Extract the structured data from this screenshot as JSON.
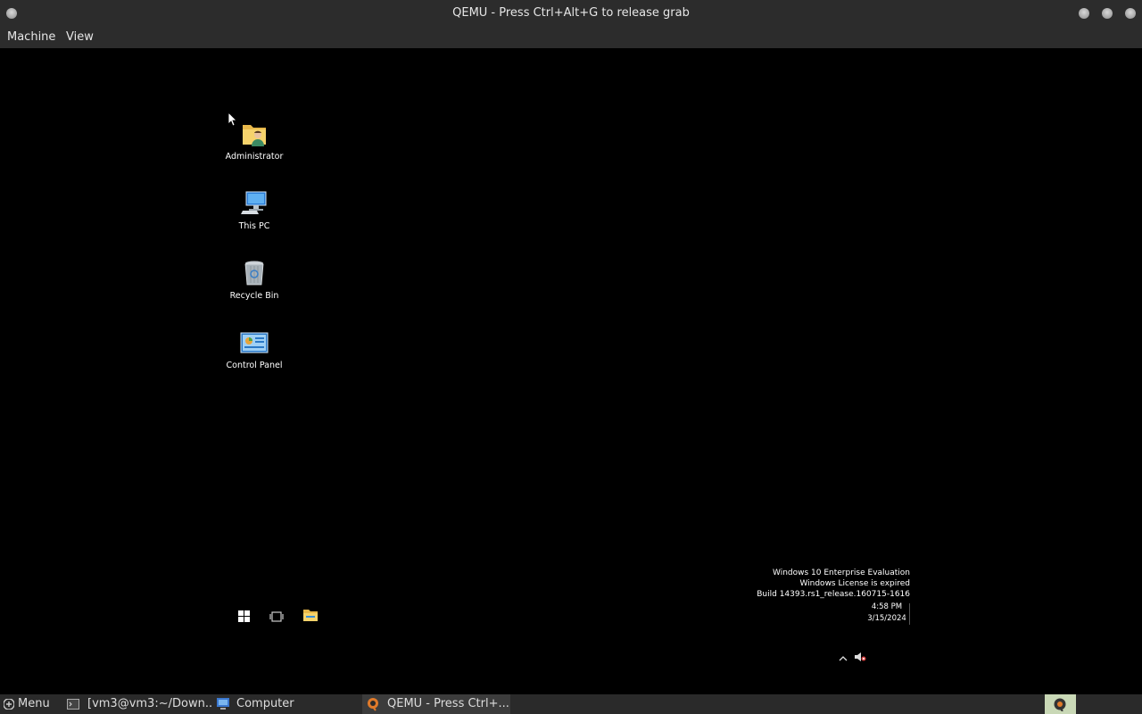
{
  "window": {
    "title": "QEMU - Press Ctrl+Alt+G to release grab"
  },
  "menubar": {
    "items": [
      "Machine",
      "View"
    ]
  },
  "desktop": {
    "icons": [
      {
        "label": "Administrator",
        "icon": "user-folder-icon"
      },
      {
        "label": "This PC",
        "icon": "computer-icon"
      },
      {
        "label": "Recycle Bin",
        "icon": "recycle-bin-icon"
      },
      {
        "label": "Control Panel",
        "icon": "control-panel-icon"
      }
    ],
    "watermark": {
      "line1": "Windows 10 Enterprise Evaluation",
      "line2": "Windows License is expired",
      "line3": "Build 14393.rs1_release.160715-1616"
    },
    "clock": {
      "time": "4:58 PM",
      "date": "3/15/2024"
    }
  },
  "host_taskbar": {
    "menu_label": "Menu",
    "items": [
      {
        "label": "[vm3@vm3:~/Down...",
        "icon": "terminal-icon",
        "active": false
      },
      {
        "label": "Computer",
        "icon": "computer-icon",
        "active": false
      },
      {
        "label": "QEMU - Press Ctrl+...",
        "icon": "qemu-icon",
        "active": true
      }
    ]
  },
  "colors": {
    "titlebar": "#2c2c2c",
    "desktop": "#000000",
    "taskbar": "#2a2a2a",
    "tray_accent": "#c9d8b6"
  }
}
